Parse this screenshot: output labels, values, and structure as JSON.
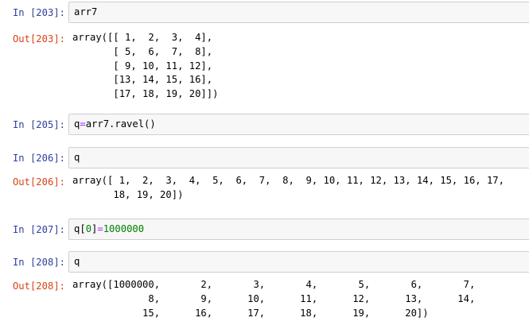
{
  "cells": [
    {
      "in_prompt": "In [203]:",
      "code": "arr7",
      "out_prompt": "Out[203]:",
      "output": "array([[ 1,  2,  3,  4],\n       [ 5,  6,  7,  8],\n       [ 9, 10, 11, 12],\n       [13, 14, 15, 16],\n       [17, 18, 19, 20]])"
    },
    {
      "in_prompt": "In [205]:",
      "code_parts": [
        "q",
        "=",
        "arr7.ravel()"
      ]
    },
    {
      "in_prompt": "In [206]:",
      "code": "q",
      "out_prompt": "Out[206]:",
      "output": "array([ 1,  2,  3,  4,  5,  6,  7,  8,  9, 10, 11, 12, 13, 14, 15, 16, 17,\n       18, 19, 20])"
    },
    {
      "in_prompt": "In [207]:",
      "code_parts": [
        "q[",
        "0",
        "]",
        "=",
        "1000000"
      ]
    },
    {
      "in_prompt": "In [208]:",
      "code": "q",
      "out_prompt": "Out[208]:",
      "output": "array([1000000,       2,       3,       4,       5,       6,       7,\n             8,       9,      10,      11,      12,      13,      14,\n            15,      16,      17,      18,      19,      20])"
    }
  ]
}
